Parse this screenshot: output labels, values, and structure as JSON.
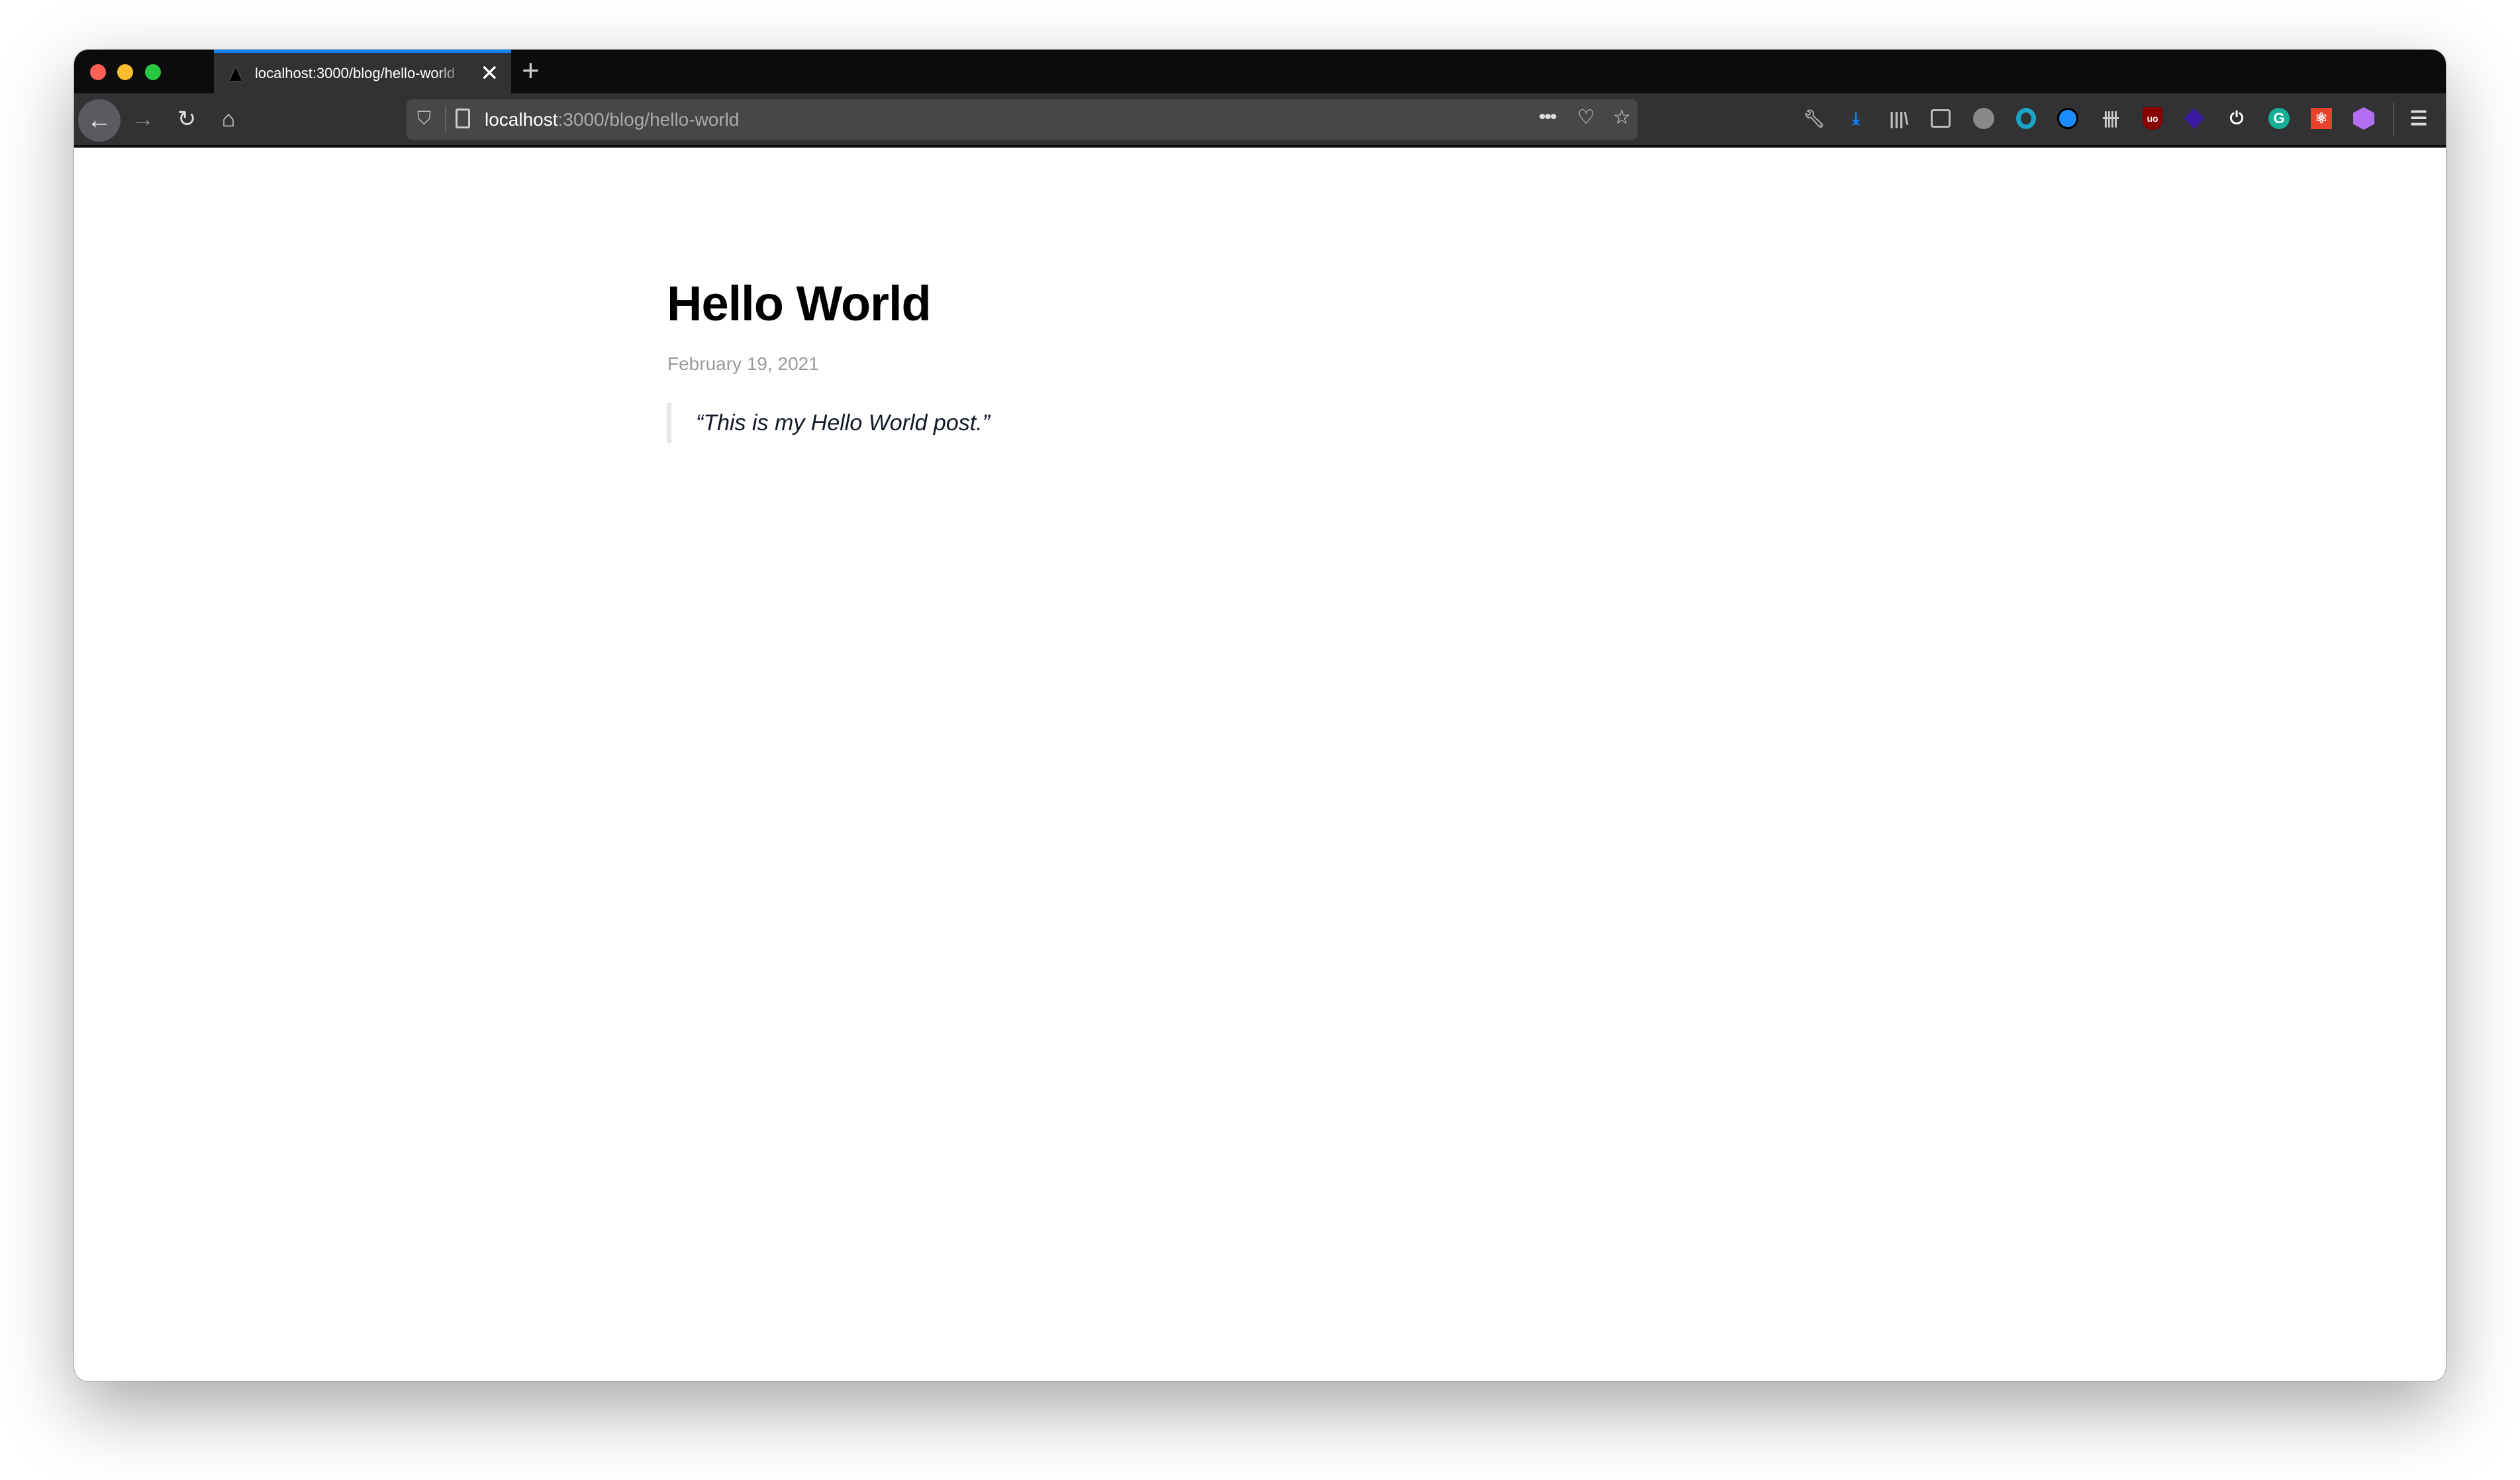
{
  "browser": {
    "tab": {
      "title": "localhost:3000/blog/hello-world",
      "close": "✕"
    },
    "new_tab": "+",
    "url": {
      "host": "localhost",
      "path": ":3000/blog/hello-world"
    },
    "icons": [
      "wrench-icon",
      "download-icon",
      "library-icon",
      "sidebar-icon",
      "avatar-extension-icon",
      "circle-extension-icon",
      "1password-icon",
      "fence-extension-icon",
      "ublock-origin-icon",
      "diamond-extension-icon",
      "power-icon",
      "grammarly-icon",
      "react-devtools-icon",
      "hexagon-extension-icon"
    ],
    "ublock_label": "uo",
    "grammarly_label": "G",
    "accent": "#0a84ff"
  },
  "post": {
    "title": "Hello World",
    "date": "February 19, 2021",
    "quote": "“This is my Hello World post.”"
  }
}
